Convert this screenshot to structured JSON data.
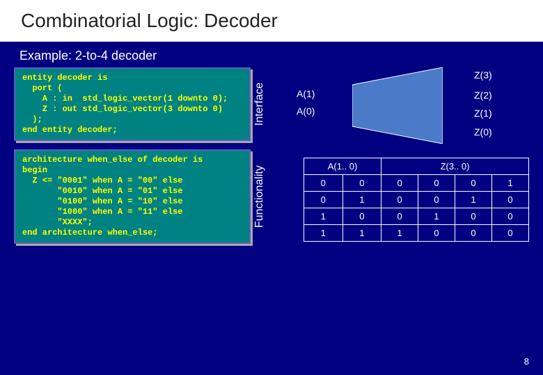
{
  "title": "Combinatorial Logic: Decoder",
  "subtitle": "Example: 2-to-4 decoder",
  "code": {
    "interface_label": "Interface",
    "interface_code": "entity decoder is\n  port (\n    A : in  std_logic_vector(1 downto 0);\n    Z : out std_logic_vector(3 downto 0)\n  );\nend entity decoder;",
    "functionality_label": "Functionality",
    "functionality_code": "architecture when_else of decoder is\nbegin\n  Z <= \"0001\" when A = \"00\" else\n       \"0010\" when A = \"01\" else\n       \"0100\" when A = \"10\" else\n       \"1000\" when A = \"11\" else\n       \"XXXX\";\nend architecture when_else;"
  },
  "diagram": {
    "inputs": [
      "A(1)",
      "A(0)"
    ],
    "outputs": [
      "Z(3)",
      "Z(2)",
      "Z(1)",
      "Z(0)"
    ]
  },
  "truth_table": {
    "header_a": "A(1.. 0)",
    "header_z": "Z(3.. 0)",
    "rows": [
      {
        "a": [
          "0",
          "0"
        ],
        "z": [
          "0",
          "0",
          "0",
          "1"
        ]
      },
      {
        "a": [
          "0",
          "1"
        ],
        "z": [
          "0",
          "0",
          "1",
          "0"
        ]
      },
      {
        "a": [
          "1",
          "0"
        ],
        "z": [
          "0",
          "1",
          "0",
          "0"
        ]
      },
      {
        "a": [
          "1",
          "1"
        ],
        "z": [
          "1",
          "0",
          "0",
          "0"
        ]
      }
    ]
  },
  "page_number": "8"
}
